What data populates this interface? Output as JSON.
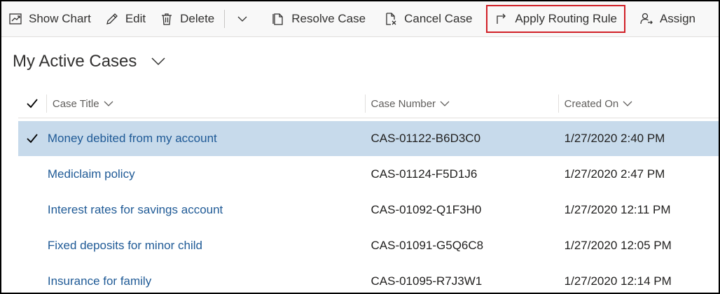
{
  "toolbar": {
    "show_chart": "Show Chart",
    "edit": "Edit",
    "delete": "Delete",
    "resolve_case": "Resolve Case",
    "cancel_case": "Cancel Case",
    "apply_routing_rule": "Apply Routing Rule",
    "assign": "Assign"
  },
  "view": {
    "title": "My Active Cases"
  },
  "grid": {
    "columns": [
      "Case Title",
      "Case Number",
      "Created On"
    ],
    "rows": [
      {
        "title": "Money debited from my account",
        "number": "CAS-01122-B6D3C0",
        "created": "1/27/2020 2:40 PM",
        "selected": true
      },
      {
        "title": "Mediclaim policy",
        "number": "CAS-01124-F5D1J6",
        "created": "1/27/2020 2:47 PM",
        "selected": false
      },
      {
        "title": "Interest rates for savings account",
        "number": "CAS-01092-Q1F3H0",
        "created": "1/27/2020 12:11 PM",
        "selected": false
      },
      {
        "title": "Fixed deposits for minor child",
        "number": "CAS-01091-G5Q6C8",
        "created": "1/27/2020 12:05 PM",
        "selected": false
      },
      {
        "title": "Insurance for family",
        "number": "CAS-01095-R7J3W1",
        "created": "1/27/2020 12:14 PM",
        "selected": false
      }
    ]
  },
  "colors": {
    "selected_row": "#c7daeb",
    "link": "#1f5a96",
    "highlight_box": "#d11f26"
  }
}
